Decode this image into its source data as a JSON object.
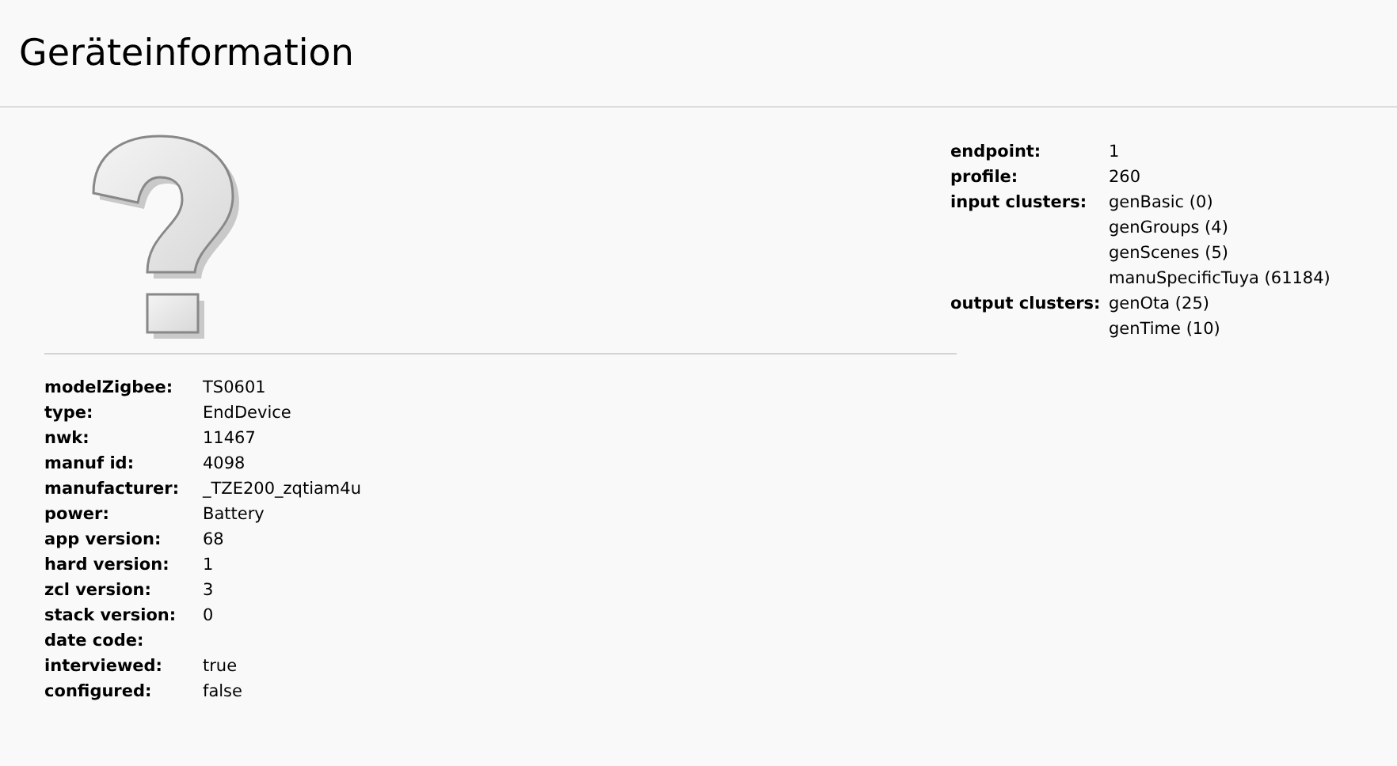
{
  "title": "Geräteinformation",
  "device_info": [
    {
      "label": "modelZigbee:",
      "value": "TS0601"
    },
    {
      "label": "type:",
      "value": "EndDevice"
    },
    {
      "label": "nwk:",
      "value": "11467"
    },
    {
      "label": "manuf id:",
      "value": "4098"
    },
    {
      "label": "manufacturer:",
      "value": "_TZE200_zqtiam4u"
    },
    {
      "label": "power:",
      "value": "Battery"
    },
    {
      "label": "app version:",
      "value": "68"
    },
    {
      "label": "hard version:",
      "value": "1"
    },
    {
      "label": "zcl version:",
      "value": "3"
    },
    {
      "label": "stack version:",
      "value": "0"
    },
    {
      "label": "date code:"
    },
    {
      "label": "interviewed:",
      "value": "true"
    },
    {
      "label": "configured:",
      "value": "false"
    }
  ],
  "endpoint_info": [
    {
      "label": "endpoint:",
      "values": [
        "1"
      ]
    },
    {
      "label": "profile:",
      "values": [
        "260"
      ]
    },
    {
      "label": "input clusters:",
      "values": [
        "genBasic (0)",
        "genGroups (4)",
        "genScenes (5)",
        "manuSpecificTuya (61184)"
      ]
    },
    {
      "label": "output clusters:",
      "values": [
        "genOta (25)",
        "genTime (10)"
      ]
    }
  ]
}
